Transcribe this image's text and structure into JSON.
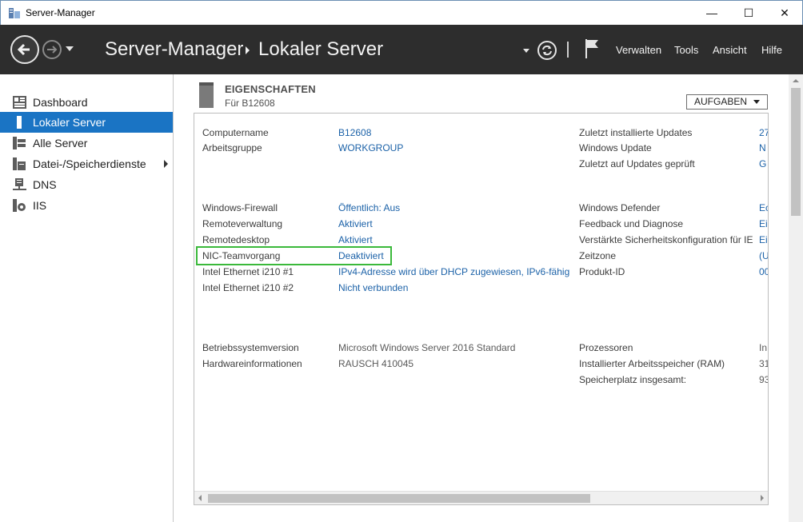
{
  "window": {
    "title": "Server-Manager",
    "minimize": "—",
    "maximize": "☐",
    "close": "✕"
  },
  "header": {
    "app": "Server-Manager",
    "page": "Lokaler Server",
    "menu": [
      "Verwalten",
      "Tools",
      "Ansicht",
      "Hilfe"
    ]
  },
  "sidebar": {
    "items": [
      {
        "label": "Dashboard",
        "icon": "dashboard-icon"
      },
      {
        "label": "Lokaler Server",
        "icon": "server-icon",
        "active": true
      },
      {
        "label": "Alle Server",
        "icon": "servers-icon"
      },
      {
        "label": "Datei-/Speicherdienste",
        "icon": "storage-icon",
        "has_submenu": true
      },
      {
        "label": "DNS",
        "icon": "dns-icon"
      },
      {
        "label": "IIS",
        "icon": "iis-icon"
      }
    ]
  },
  "properties": {
    "title": "EIGENSCHAFTEN",
    "subtitle": "Für B12608",
    "tasks_button": "AUFGABEN",
    "left": [
      {
        "name": "Computername",
        "value": "B12608",
        "link": true
      },
      {
        "name": "Arbeitsgruppe",
        "value": "WORKGROUP",
        "link": true
      },
      {
        "name": "Windows-Firewall",
        "value": "Öffentlich: Aus",
        "link": true
      },
      {
        "name": "Remoteverwaltung",
        "value": "Aktiviert",
        "link": true
      },
      {
        "name": "Remotedesktop",
        "value": "Aktiviert",
        "link": true
      },
      {
        "name": "NIC-Teamvorgang",
        "value": "Deaktiviert",
        "link": true
      },
      {
        "name": "Intel Ethernet i210 #1",
        "value": "IPv4-Adresse wird über DHCP zugewiesen, IPv6-fähig",
        "link": true
      },
      {
        "name": "Intel Ethernet i210 #2",
        "value": "Nicht verbunden",
        "link": true
      },
      {
        "name": "Betriebssystemversion",
        "value": "Microsoft Windows Server 2016 Standard",
        "link": false
      },
      {
        "name": "Hardwareinformationen",
        "value": "RAUSCH 410045",
        "link": false
      }
    ],
    "right": [
      {
        "name": "Zuletzt installierte Updates",
        "value": "27"
      },
      {
        "name": "Windows Update",
        "value": "N"
      },
      {
        "name": "Zuletzt auf Updates geprüft",
        "value": "G"
      },
      {
        "name": "Windows Defender",
        "value": "Ec"
      },
      {
        "name": "Feedback und Diagnose",
        "value": "Ei"
      },
      {
        "name": "Verstärkte Sicherheitskonfiguration für IE",
        "value": "Ei"
      },
      {
        "name": "Zeitzone",
        "value": "(U"
      },
      {
        "name": "Produkt-ID",
        "value": "00"
      },
      {
        "name": "Prozessoren",
        "value": "In"
      },
      {
        "name": "Installierter Arbeitsspeicher (RAM)",
        "value": "31"
      },
      {
        "name": "Speicherplatz insgesamt:",
        "value": "93"
      }
    ]
  },
  "colors": {
    "header_bg": "#2d2d2d",
    "active_item": "#1a74c4",
    "link": "#1c62a8",
    "highlight_box": "#3bb93b"
  }
}
